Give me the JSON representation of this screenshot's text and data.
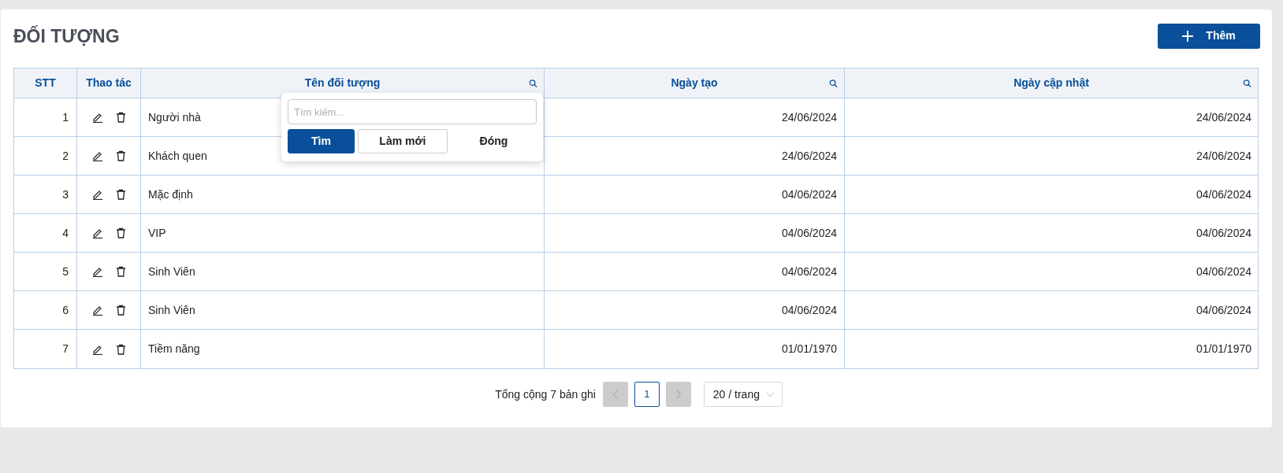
{
  "title": "ĐỐI TƯỢNG",
  "add_button": "Thêm",
  "table": {
    "columns": [
      {
        "label": "STT",
        "searchable": false
      },
      {
        "label": "Thao tác",
        "searchable": false
      },
      {
        "label": "Tên đối tượng",
        "searchable": true
      },
      {
        "label": "Ngày tạo",
        "searchable": true
      },
      {
        "label": "Ngày cập nhật",
        "searchable": true
      }
    ],
    "rows": [
      {
        "stt": "1",
        "name": "Người nhà",
        "created": "24/06/2024",
        "updated": "24/06/2024"
      },
      {
        "stt": "2",
        "name": "Khách quen",
        "created": "24/06/2024",
        "updated": "24/06/2024"
      },
      {
        "stt": "3",
        "name": "Mặc định",
        "created": "04/06/2024",
        "updated": "04/06/2024"
      },
      {
        "stt": "4",
        "name": "VIP",
        "created": "04/06/2024",
        "updated": "04/06/2024"
      },
      {
        "stt": "5",
        "name": "Sinh Viên",
        "created": "04/06/2024",
        "updated": "04/06/2024"
      },
      {
        "stt": "6",
        "name": "Sinh Viên",
        "created": "04/06/2024",
        "updated": "04/06/2024"
      },
      {
        "stt": "7",
        "name": "Tiềm năng",
        "created": "01/01/1970",
        "updated": "01/01/1970"
      }
    ]
  },
  "search_popup": {
    "placeholder": "Tìm kiếm...",
    "buttons": [
      "Tìm",
      "Làm mới",
      "Đóng"
    ]
  },
  "pagination": {
    "total": "Tổng cộng 7 bản ghi",
    "prev_disabled": true,
    "next_disabled": true,
    "pages": [
      {
        "label": "1",
        "selected": true
      }
    ],
    "page_size": "20 / trang"
  }
}
